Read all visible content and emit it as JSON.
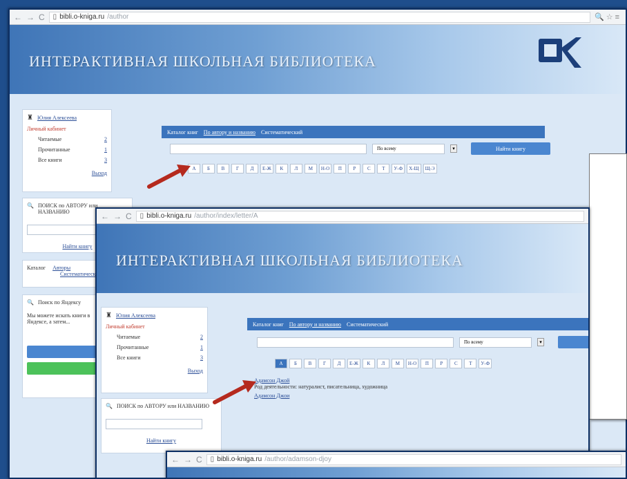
{
  "browser": {
    "url_host_1": "bibli.o-kniga.ru",
    "url_path_1": "/author",
    "url_host_2": "bibli.o-kniga.ru",
    "url_path_2": "/author/index/letter/A",
    "url_host_3": "bibli.o-kniga.ru",
    "url_path_3": "/author/adamson-djoy"
  },
  "site": {
    "title": "ИНТЕРАКТИВНАЯ ШКОЛЬНАЯ БИБЛИОТЕКА"
  },
  "user_box": {
    "username": "Юлия Алексеева",
    "cabinet": "Личный кабинет",
    "items": [
      {
        "label": "Читаемые",
        "count": "2"
      },
      {
        "label": "Прочитанные",
        "count": "1"
      },
      {
        "label": "Все книги",
        "count": "3"
      }
    ],
    "logout": "Выход"
  },
  "search_box": {
    "title": "ПОИСК по АВТОРУ или НАЗВАНИЮ",
    "button": "Найти книгу"
  },
  "catalog_box": {
    "label": "Каталог",
    "authors": "Авторы",
    "systematic": "Систематический"
  },
  "search_panel": {
    "tabs": [
      "Каталог книг",
      "По автору и названию",
      "Систематический"
    ],
    "select_value": "По всему",
    "find_button": "Найти книгу"
  },
  "letters": [
    "А",
    "Б",
    "В",
    "Г",
    "Д",
    "Е-Ж",
    "К",
    "Л",
    "М",
    "Н-О",
    "П",
    "Р",
    "С",
    "Т",
    "У-Ф",
    "Х-Щ",
    "Щ-Э"
  ],
  "results": {
    "author1": "Адамсон Джой",
    "author1_desc": "Род деятельности: натуралист, писательница, художница",
    "author2": "Адамсон Джои"
  },
  "sidebar_misc": {
    "yandex_search": "Поиск по Яндексу",
    "help_text": "Мы можете искать книги в Яндексе, а затем..."
  }
}
